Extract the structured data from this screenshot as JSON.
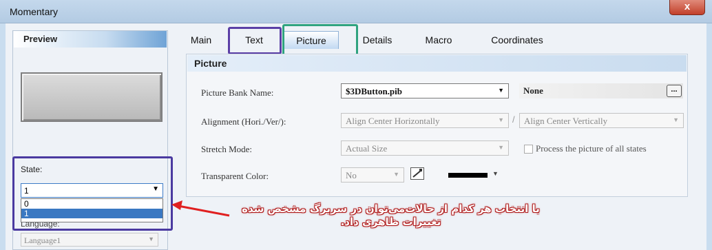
{
  "window": {
    "title": "Momentary",
    "close_label": "x"
  },
  "preview": {
    "header": "Preview",
    "state_label": "State:",
    "state_value": "1",
    "state_options": [
      "0",
      "1"
    ],
    "language_label": "Language:",
    "language_value": "Language1"
  },
  "tabs": [
    {
      "label": "Main"
    },
    {
      "label": "Text"
    },
    {
      "label": "Picture"
    },
    {
      "label": "Details"
    },
    {
      "label": "Macro"
    },
    {
      "label": "Coordinates"
    }
  ],
  "picture": {
    "header": "Picture",
    "bank_label": "Picture Bank Name:",
    "bank_value": "$3DButton.pib",
    "bank_name_value": "None",
    "browse_label": "...",
    "alignment_label": "Alignment (Hori./Ver/):",
    "align_h_value": "Align Center Horizontally",
    "align_v_value": "Align Center Vertically",
    "stretch_label": "Stretch Mode:",
    "stretch_value": "Actual Size",
    "process_all_label": "Process the picture of all states",
    "transparent_label": "Transparent Color:",
    "transparent_value": "No",
    "color_swatch": "#000000"
  },
  "annotation": {
    "line1": "با انتخاب هر کدام از حالات‌می‌توان در سربرگ مشخص شده",
    "line2": "تغییرات ظاهری داد."
  },
  "colors": {
    "text_highlight_box": "#5b3fa6",
    "picture_highlight_box": "#2fa37f",
    "state_highlight_box": "#4a3aa0",
    "annotation_arrow": "#e02020"
  }
}
